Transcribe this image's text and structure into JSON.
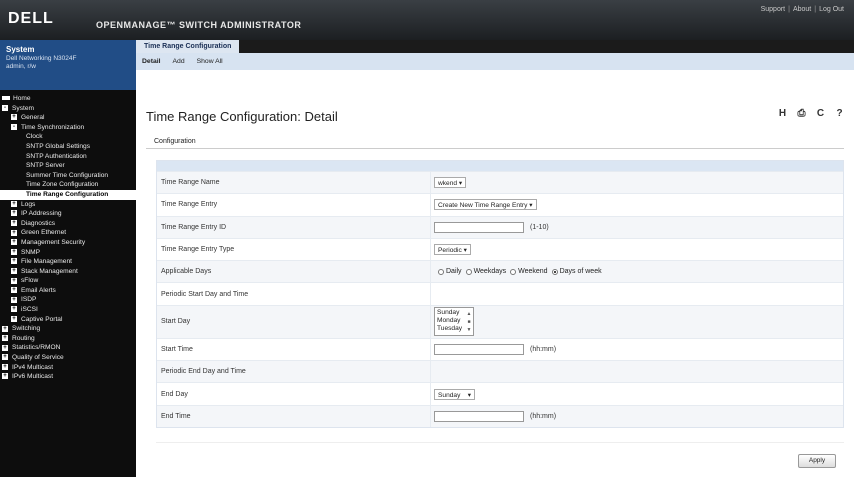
{
  "header": {
    "logo": "DELL",
    "title": "OPENMANAGE™ SWITCH ADMINISTRATOR",
    "links": [
      "Support",
      "About",
      "Log Out"
    ]
  },
  "sidebar": {
    "system_title": "System",
    "device": "Dell Networking N3024F",
    "user": "admin, r/w",
    "items": [
      {
        "label": "Home",
        "indent": 0,
        "exp": ""
      },
      {
        "label": "System",
        "indent": 0,
        "exp": "-"
      },
      {
        "label": "General",
        "indent": 1,
        "exp": "+"
      },
      {
        "label": "Time Synchronization",
        "indent": 1,
        "exp": "-"
      },
      {
        "label": "Clock",
        "indent": 2,
        "exp": ""
      },
      {
        "label": "SNTP Global Settings",
        "indent": 2,
        "exp": ""
      },
      {
        "label": "SNTP Authentication",
        "indent": 2,
        "exp": ""
      },
      {
        "label": "SNTP Server",
        "indent": 2,
        "exp": ""
      },
      {
        "label": "Summer Time Configuration",
        "indent": 2,
        "exp": ""
      },
      {
        "label": "Time Zone Configuration",
        "indent": 2,
        "exp": ""
      },
      {
        "label": "Time Range Configuration",
        "indent": 2,
        "exp": "",
        "selected": true
      },
      {
        "label": "Logs",
        "indent": 1,
        "exp": "+"
      },
      {
        "label": "IP Addressing",
        "indent": 1,
        "exp": "+"
      },
      {
        "label": "Diagnostics",
        "indent": 1,
        "exp": "+"
      },
      {
        "label": "Green Ethernet",
        "indent": 1,
        "exp": "+"
      },
      {
        "label": "Management Security",
        "indent": 1,
        "exp": "+"
      },
      {
        "label": "SNMP",
        "indent": 1,
        "exp": "+"
      },
      {
        "label": "File Management",
        "indent": 1,
        "exp": "+"
      },
      {
        "label": "Stack Management",
        "indent": 1,
        "exp": "+"
      },
      {
        "label": "sFlow",
        "indent": 1,
        "exp": "+"
      },
      {
        "label": "Email Alerts",
        "indent": 1,
        "exp": "+"
      },
      {
        "label": "ISDP",
        "indent": 1,
        "exp": "+"
      },
      {
        "label": "iSCSI",
        "indent": 1,
        "exp": "+"
      },
      {
        "label": "Captive Portal",
        "indent": 1,
        "exp": "+"
      },
      {
        "label": "Switching",
        "indent": 0,
        "exp": "+"
      },
      {
        "label": "Routing",
        "indent": 0,
        "exp": "+"
      },
      {
        "label": "Statistics/RMON",
        "indent": 0,
        "exp": "+"
      },
      {
        "label": "Quality of Service",
        "indent": 0,
        "exp": "+"
      },
      {
        "label": "IPv4 Multicast",
        "indent": 0,
        "exp": "+"
      },
      {
        "label": "IPv6 Multicast",
        "indent": 0,
        "exp": "+"
      }
    ]
  },
  "tabs": {
    "active": "Time Range Configuration",
    "subnav": [
      "Detail",
      "Add",
      "Show All"
    ]
  },
  "main": {
    "title": "Time Range Configuration: Detail",
    "section": "Configuration",
    "tools": {
      "help_label": "H",
      "print_label": "⎙",
      "refresh_label": "C",
      "question_label": "?"
    },
    "fields": {
      "name_label": "Time Range Name",
      "name_value": "wkend",
      "entry_label": "Time Range Entry",
      "entry_value": "Create New Time Range Entry",
      "entry_id_label": "Time Range Entry ID",
      "entry_id_hint": "(1-10)",
      "entry_type_label": "Time Range Entry Type",
      "entry_type_value": "Periodic",
      "days_label": "Applicable Days",
      "days_options": [
        "Daily",
        "Weekdays",
        "Weekend",
        "Days of week"
      ],
      "periodic_start_label": "Periodic Start Day and Time",
      "start_day_label": "Start Day",
      "start_day_options": [
        "Sunday",
        "Monday",
        "Tuesday"
      ],
      "start_time_label": "Start Time",
      "start_time_hint": "(hh:mm)",
      "periodic_end_label": "Periodic End Day and Time",
      "end_day_label": "End Day",
      "end_day_value": "Sunday",
      "end_time_label": "End Time",
      "end_time_hint": "(hh:mm)"
    },
    "apply_label": "Apply"
  }
}
